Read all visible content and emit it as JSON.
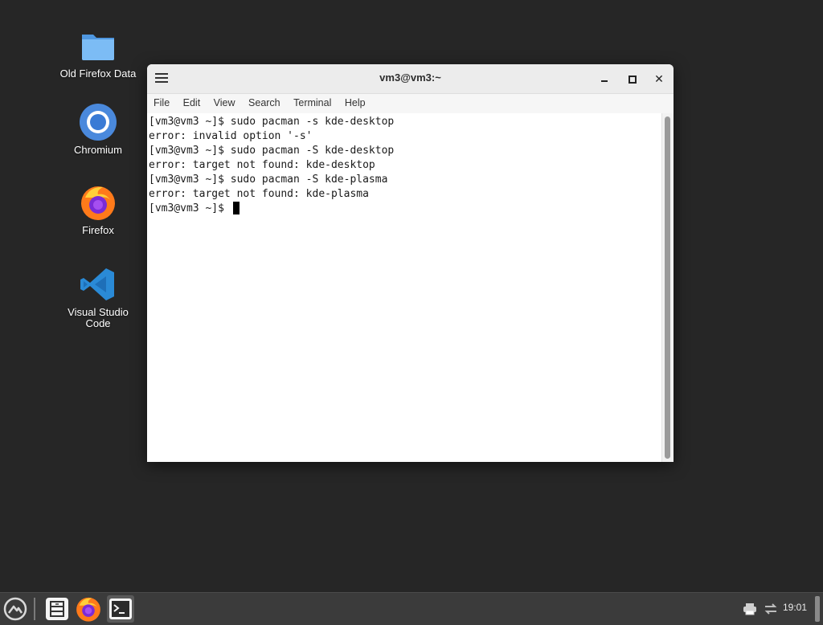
{
  "desktop": {
    "icons": [
      {
        "label": "Old Firefox Data",
        "icon": "folder-icon"
      },
      {
        "label": "Chromium",
        "icon": "chromium-icon"
      },
      {
        "label": "Firefox",
        "icon": "firefox-icon"
      },
      {
        "label": "Visual Studio Code",
        "icon": "vscode-icon"
      }
    ]
  },
  "window": {
    "title": "vm3@vm3:~",
    "menu": [
      "File",
      "Edit",
      "View",
      "Search",
      "Terminal",
      "Help"
    ]
  },
  "terminal": {
    "lines": [
      "[vm3@vm3 ~]$ sudo pacman -s kde-desktop",
      "error: invalid option '-s'",
      "[vm3@vm3 ~]$ sudo pacman -S kde-desktop",
      "error: target not found: kde-desktop",
      "[vm3@vm3 ~]$ sudo pacman -S kde-plasma",
      "error: target not found: kde-plasma"
    ],
    "prompt": "[vm3@vm3 ~]$ "
  },
  "taskbar": {
    "items": [
      "app-menu-icon",
      "file-manager-icon",
      "firefox-icon",
      "terminal-icon"
    ],
    "clock": "19:01"
  },
  "colors": {
    "desktop_bg": "#262626",
    "taskbar_bg": "#3b3b3b",
    "folder_blue": "#5aa7f0",
    "vscode_blue": "#2a8ad6"
  }
}
